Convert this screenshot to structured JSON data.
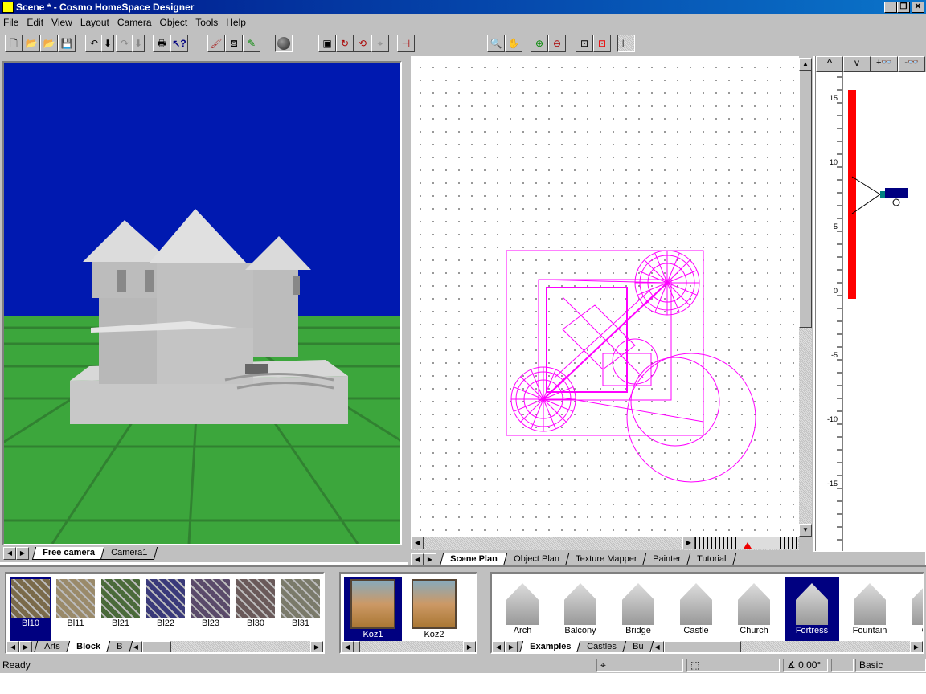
{
  "window": {
    "title": "Scene * - Cosmo HomeSpace Designer",
    "controls": [
      "_",
      "❐",
      "✕"
    ]
  },
  "menu": [
    "File",
    "Edit",
    "View",
    "Layout",
    "Camera",
    "Object",
    "Tools",
    "Help"
  ],
  "toolbar": {
    "icons": [
      "new-file",
      "open-samples",
      "open-folder",
      "save",
      "undo",
      "undo-list",
      "redo",
      "redo-list",
      "print",
      "context-help",
      "paint-brush",
      "paint-bucket",
      "eyedropper",
      "render-sphere",
      "camera-window",
      "camera-orbit",
      "camera-tilt",
      "camera-target",
      "camera-elevation",
      "zoom",
      "pan-hand",
      "zoom-in",
      "zoom-out",
      "fit-all",
      "fit-selection",
      "camera-view-toggle"
    ]
  },
  "view3d": {
    "sky_color": "#0019b0",
    "ground_color": "#3ca63c",
    "tabs": [
      "Free camera",
      "Camera1"
    ],
    "active_tab": 0
  },
  "plan": {
    "line_color": "#ff00ff",
    "tabs": [
      "Scene Plan",
      "Object Plan",
      "Texture Mapper",
      "Painter",
      "Tutorial"
    ],
    "active_tab": 0
  },
  "elevation": {
    "buttons": [
      "^",
      "v",
      "+binoculars",
      "-binoculars"
    ],
    "ticks": [
      "15",
      "10",
      "5",
      "0",
      "-5",
      "-10",
      "-15"
    ],
    "bar_color": "#ff0000",
    "bar_range": [
      0,
      16
    ],
    "camera_height": 8
  },
  "textures": {
    "items": [
      "Bl10",
      "Bl11",
      "Bl21",
      "Bl22",
      "Bl23",
      "Bl30",
      "Bl31"
    ],
    "selected": 0,
    "colors": [
      "#7a6a4a",
      "#9a8a6a",
      "#4a6a3a",
      "#3a3a7a",
      "#5a4a6a",
      "#6a5a5a",
      "#7a7a6a"
    ],
    "tabs": [
      "Arts",
      "Block",
      "B"
    ],
    "active_tab": 1
  },
  "paintings": {
    "items": [
      "Koz1",
      "Koz2"
    ],
    "selected": 0
  },
  "objects": {
    "items": [
      "Arch",
      "Balcony",
      "Bridge",
      "Castle",
      "Church",
      "Fortress",
      "Fountain",
      "Ga"
    ],
    "selected": 5,
    "tabs": [
      "Examples",
      "Castles",
      "Bu"
    ],
    "active_tab": 0
  },
  "status": {
    "text": "Ready",
    "angle": "0.00°",
    "mode": "Basic"
  }
}
